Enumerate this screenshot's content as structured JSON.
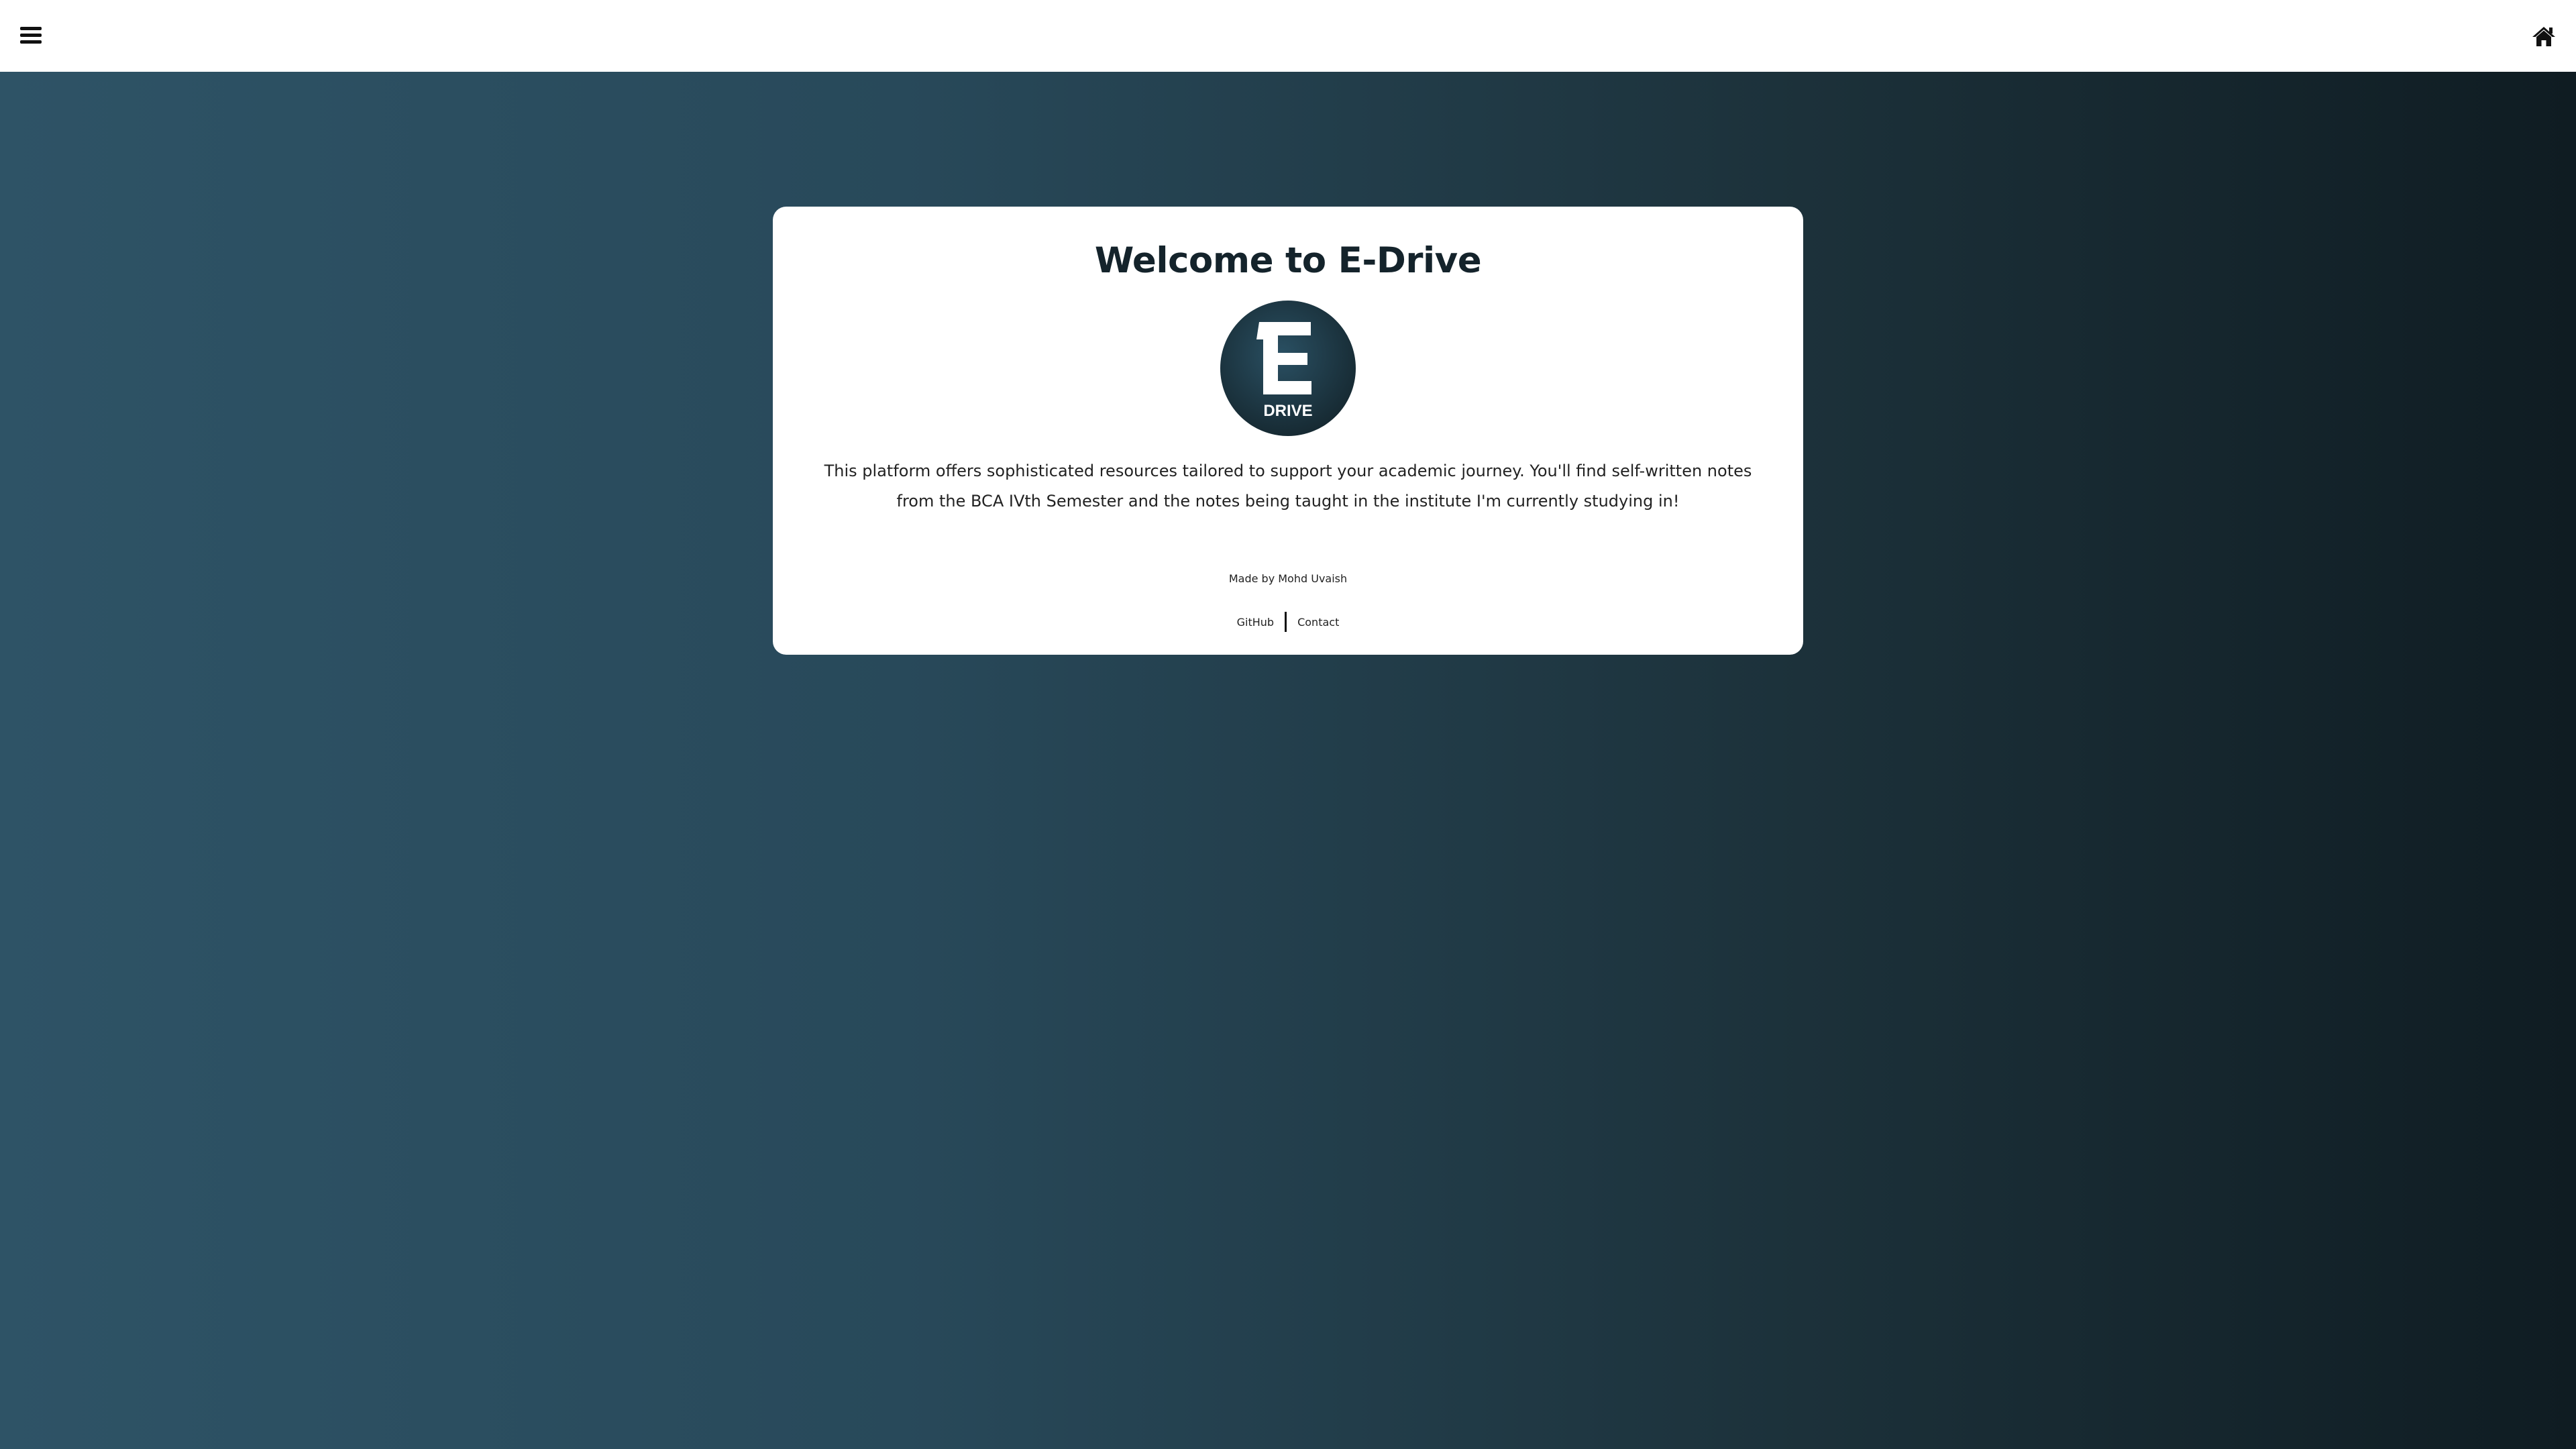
{
  "nav": {
    "menu_icon": "hamburger-menu-icon",
    "home_icon": "home-icon"
  },
  "card": {
    "title": "Welcome to E-Drive",
    "logo": {
      "icon": "e-drive-logo",
      "letter": "E",
      "word": "DRIVE"
    },
    "description": "This platform offers sophisticated resources tailored to support your academic journey. You'll find self-written notes from the BCA IVth Semester and the notes being taught in the institute I'm currently studying in!",
    "credit": "Made by Mohd Uvaish",
    "links": {
      "github": "GitHub",
      "contact": "Contact"
    }
  },
  "colors": {
    "background_left": "#2e5366",
    "background_right": "#0f1c22",
    "logo_circle": "#1d3a47",
    "card": "#ffffff"
  }
}
